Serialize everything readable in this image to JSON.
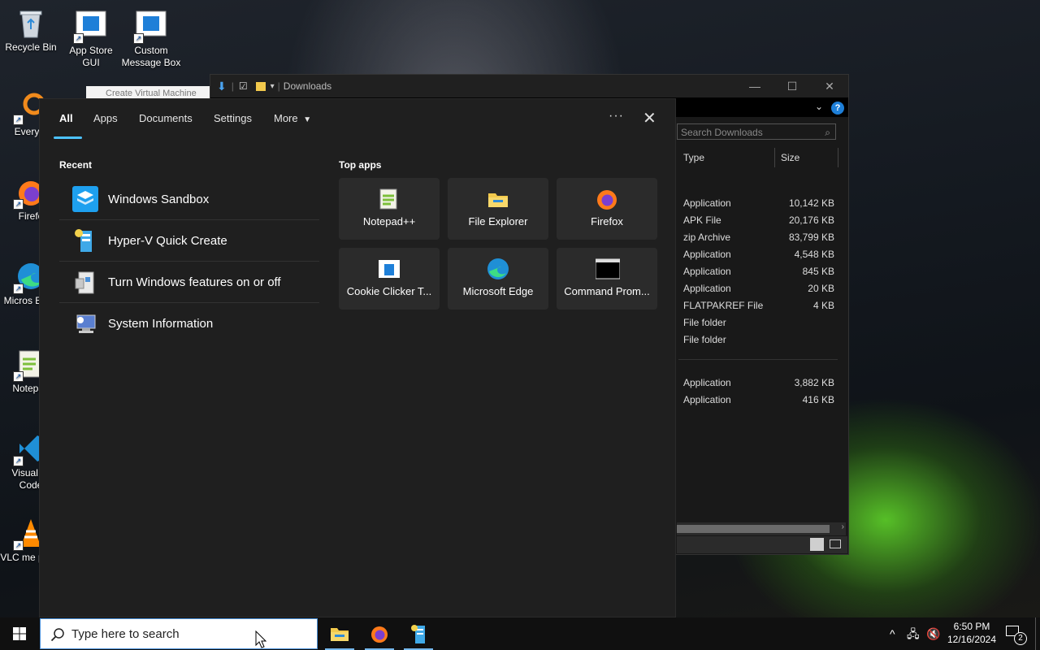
{
  "desktop": {
    "icons": [
      {
        "label": "Recycle Bin"
      },
      {
        "label": "App Store GUI"
      },
      {
        "label": "Custom Message Box"
      },
      {
        "label": "Everyth"
      },
      {
        "label": "Firefo"
      },
      {
        "label": "Micros Edge"
      },
      {
        "label": "Notepad"
      },
      {
        "label": "Visual St Code"
      },
      {
        "label": "VLC me playe"
      }
    ],
    "vm_hint": "Create Virtual Machine"
  },
  "explorer": {
    "title": "Downloads",
    "search_placeholder": "Search Downloads",
    "columns": {
      "type": "Type",
      "size": "Size"
    },
    "rows": [
      {
        "type": "Application",
        "size": "10,142 KB"
      },
      {
        "type": "APK File",
        "size": "20,176 KB"
      },
      {
        "type": "zip Archive",
        "size": "83,799 KB"
      },
      {
        "type": "Application",
        "size": "4,548 KB"
      },
      {
        "type": "Application",
        "size": "845 KB"
      },
      {
        "type": "Application",
        "size": "20 KB"
      },
      {
        "type": "FLATPAKREF File",
        "size": "4 KB"
      },
      {
        "type": "File folder",
        "size": ""
      },
      {
        "type": "File folder",
        "size": ""
      },
      {
        "type": "Application",
        "size": "3,882 KB"
      },
      {
        "type": "Application",
        "size": "416 KB"
      }
    ]
  },
  "search_panel": {
    "tabs": [
      "All",
      "Apps",
      "Documents",
      "Settings",
      "More"
    ],
    "recent_heading": "Recent",
    "recent": [
      {
        "label": "Windows Sandbox",
        "icon": "sandbox-icon"
      },
      {
        "label": "Hyper-V Quick Create",
        "icon": "hyperv-icon"
      },
      {
        "label": "Turn Windows features on or off",
        "icon": "windows-features-icon"
      },
      {
        "label": "System Information",
        "icon": "system-info-icon"
      }
    ],
    "top_apps_heading": "Top apps",
    "top_apps": [
      {
        "label": "Notepad++",
        "icon": "notepadpp-icon"
      },
      {
        "label": "File Explorer",
        "icon": "folder-icon"
      },
      {
        "label": "Firefox",
        "icon": "firefox-icon"
      },
      {
        "label": "Cookie Clicker T...",
        "icon": "app-window-icon"
      },
      {
        "label": "Microsoft Edge",
        "icon": "edge-icon"
      },
      {
        "label": "Command Prom...",
        "icon": "terminal-icon"
      }
    ]
  },
  "taskbar": {
    "search_placeholder": "Type here to search",
    "time": "6:50 PM",
    "date": "12/16/2024",
    "notification_count": "2"
  }
}
